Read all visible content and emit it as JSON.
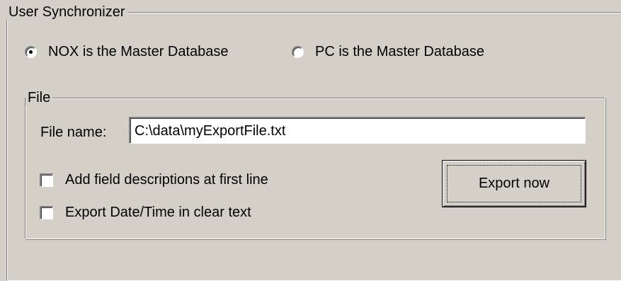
{
  "user_synchronizer": {
    "title": "User Synchronizer",
    "master_options": [
      {
        "label": "NOX is the Master Database",
        "checked": true
      },
      {
        "label": "PC is the Master Database",
        "checked": false
      }
    ]
  },
  "file": {
    "title": "File",
    "filename_label": "File name:",
    "filename_value": "C:\\data\\myExportFile.txt",
    "options": [
      {
        "label": "Add field descriptions at first line",
        "checked": false
      },
      {
        "label": "Export Date/Time in clear text",
        "checked": false
      }
    ],
    "export_button_label": "Export now"
  }
}
